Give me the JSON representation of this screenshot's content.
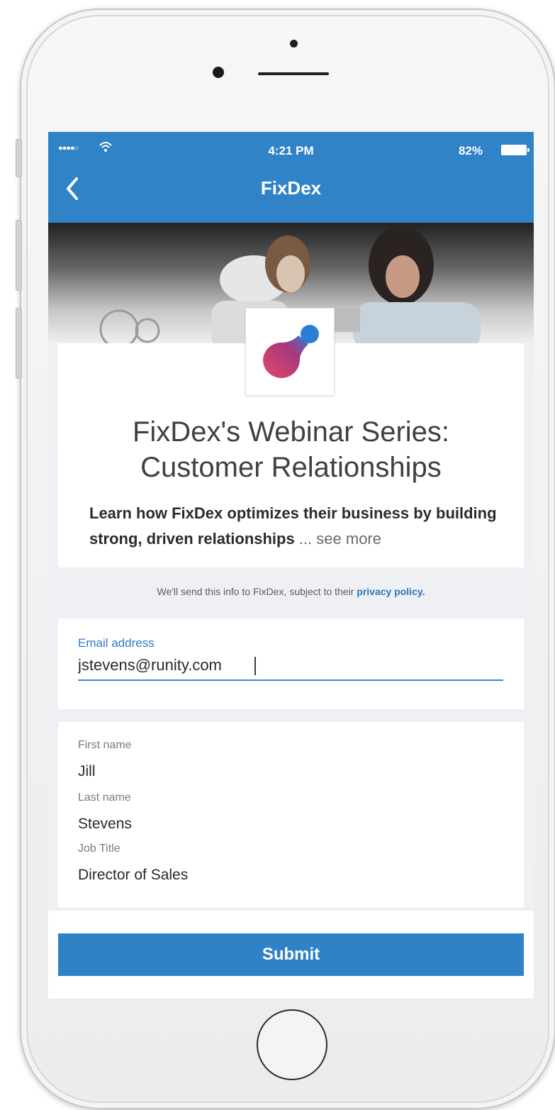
{
  "status_bar": {
    "signal": "●●●●○",
    "time": "4:21 PM",
    "battery": "82%"
  },
  "nav": {
    "title": "FixDex",
    "back_icon": "chevron-left-icon"
  },
  "event": {
    "title_line1": "FixDex's Webinar Series:",
    "title_line2": "Customer Relationships",
    "description": "Learn how FixDex optimizes their business by building strong, driven relationships",
    "see_more": " ... see more"
  },
  "privacy": {
    "text": "We'll send this info to FixDex, subject to their ",
    "link": "privacy policy."
  },
  "form": {
    "email": {
      "label": "Email address",
      "value": "jstevens@runity.com"
    },
    "first_name": {
      "label": "First name",
      "value": "Jill"
    },
    "last_name": {
      "label": "Last name",
      "value": "Stevens"
    },
    "job_title": {
      "label": "Job Title",
      "value": "Director of Sales"
    }
  },
  "submit_label": "Submit",
  "colors": {
    "brand_blue": "#3183c8",
    "logo_pink": "#d63a6e",
    "logo_blue": "#2a7fd4"
  }
}
